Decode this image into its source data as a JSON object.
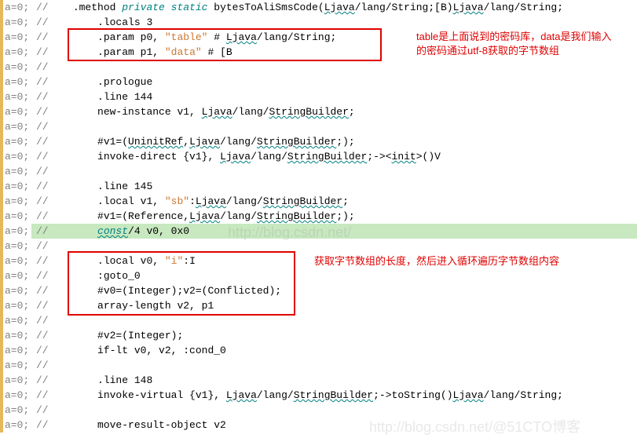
{
  "gutter_text": "a=0;",
  "comment_prefix": "//",
  "lines": [
    {
      "indent": 1,
      "segs": [
        {
          "t": ".method ",
          "cls": ""
        },
        {
          "t": "private static ",
          "cls": "kw"
        },
        {
          "t": "bytesToAliSmsCode(",
          "cls": ""
        },
        {
          "t": "Ljava",
          "cls": "wavy"
        },
        {
          "t": "/lang/String;[B)",
          "cls": ""
        },
        {
          "t": "Ljava",
          "cls": "wavy"
        },
        {
          "t": "/lang/String;",
          "cls": ""
        }
      ]
    },
    {
      "indent": 2,
      "segs": [
        {
          "t": ".locals 3",
          "cls": ""
        }
      ]
    },
    {
      "indent": 2,
      "segs": [
        {
          "t": ".param p0, ",
          "cls": ""
        },
        {
          "t": "\"table\"",
          "cls": "str"
        },
        {
          "t": "    # ",
          "cls": ""
        },
        {
          "t": "Ljava",
          "cls": "wavy"
        },
        {
          "t": "/lang/String;",
          "cls": ""
        }
      ]
    },
    {
      "indent": 2,
      "segs": [
        {
          "t": ".param p1, ",
          "cls": ""
        },
        {
          "t": "\"data\"",
          "cls": "str"
        },
        {
          "t": "    # [B",
          "cls": ""
        }
      ]
    },
    {
      "indent": 0,
      "segs": []
    },
    {
      "indent": 2,
      "segs": [
        {
          "t": ".prologue",
          "cls": ""
        }
      ]
    },
    {
      "indent": 2,
      "segs": [
        {
          "t": ".line 144",
          "cls": ""
        }
      ]
    },
    {
      "indent": 2,
      "segs": [
        {
          "t": "new-instance v1, ",
          "cls": ""
        },
        {
          "t": "Ljava",
          "cls": "wavy"
        },
        {
          "t": "/lang/",
          "cls": ""
        },
        {
          "t": "StringBuilder",
          "cls": "wavy"
        },
        {
          "t": ";",
          "cls": ""
        }
      ]
    },
    {
      "indent": 0,
      "segs": []
    },
    {
      "indent": 2,
      "segs": [
        {
          "t": "#v1=(",
          "cls": ""
        },
        {
          "t": "UninitRef",
          "cls": "wavy"
        },
        {
          "t": ",",
          "cls": ""
        },
        {
          "t": "Ljava",
          "cls": "wavy"
        },
        {
          "t": "/lang/",
          "cls": ""
        },
        {
          "t": "StringBuilder",
          "cls": "wavy"
        },
        {
          "t": ";);",
          "cls": ""
        }
      ]
    },
    {
      "indent": 2,
      "segs": [
        {
          "t": "invoke-direct {v1}, ",
          "cls": ""
        },
        {
          "t": "Ljava",
          "cls": "wavy"
        },
        {
          "t": "/lang/",
          "cls": ""
        },
        {
          "t": "StringBuilder",
          "cls": "wavy"
        },
        {
          "t": ";-><",
          "cls": ""
        },
        {
          "t": "init",
          "cls": "wavy"
        },
        {
          "t": ">()V",
          "cls": ""
        }
      ]
    },
    {
      "indent": 0,
      "segs": []
    },
    {
      "indent": 2,
      "segs": [
        {
          "t": ".line 145",
          "cls": ""
        }
      ]
    },
    {
      "indent": 2,
      "segs": [
        {
          "t": ".local v1, ",
          "cls": ""
        },
        {
          "t": "\"sb\"",
          "cls": "str"
        },
        {
          "t": ":",
          "cls": ""
        },
        {
          "t": "Ljava",
          "cls": "wavy"
        },
        {
          "t": "/lang/",
          "cls": ""
        },
        {
          "t": "StringBuilder",
          "cls": "wavy"
        },
        {
          "t": ";",
          "cls": ""
        }
      ]
    },
    {
      "indent": 2,
      "segs": [
        {
          "t": "#v1=(Reference,",
          "cls": ""
        },
        {
          "t": "Ljava",
          "cls": "wavy"
        },
        {
          "t": "/lang/",
          "cls": ""
        },
        {
          "t": "StringBuilder",
          "cls": "wavy"
        },
        {
          "t": ";);",
          "cls": ""
        }
      ]
    },
    {
      "indent": 2,
      "hl": true,
      "segs": [
        {
          "t": "const",
          "cls": "wavy kw"
        },
        {
          "t": "/4 v0, 0x0",
          "cls": ""
        }
      ]
    },
    {
      "indent": 0,
      "segs": []
    },
    {
      "indent": 2,
      "segs": [
        {
          "t": ".local v0, ",
          "cls": ""
        },
        {
          "t": "\"i\"",
          "cls": "str"
        },
        {
          "t": ":I",
          "cls": ""
        }
      ]
    },
    {
      "indent": 2,
      "segs": [
        {
          "t": ":goto_0",
          "cls": ""
        }
      ]
    },
    {
      "indent": 2,
      "segs": [
        {
          "t": "#v0=(Integer);v2=(Conflicted);",
          "cls": ""
        }
      ]
    },
    {
      "indent": 2,
      "segs": [
        {
          "t": "array-length v2, p1",
          "cls": ""
        }
      ]
    },
    {
      "indent": 0,
      "segs": []
    },
    {
      "indent": 2,
      "segs": [
        {
          "t": "#v2=(Integer);",
          "cls": ""
        }
      ]
    },
    {
      "indent": 2,
      "segs": [
        {
          "t": "if-lt v0, v2, :cond_0",
          "cls": ""
        }
      ]
    },
    {
      "indent": 0,
      "segs": []
    },
    {
      "indent": 2,
      "segs": [
        {
          "t": ".line 148",
          "cls": ""
        }
      ]
    },
    {
      "indent": 2,
      "segs": [
        {
          "t": "invoke-virtual {v1}, ",
          "cls": ""
        },
        {
          "t": "Ljava",
          "cls": "wavy"
        },
        {
          "t": "/lang/",
          "cls": ""
        },
        {
          "t": "StringBuilder",
          "cls": "wavy"
        },
        {
          "t": ";->toString()",
          "cls": ""
        },
        {
          "t": "Ljava",
          "cls": "wavy"
        },
        {
          "t": "/lang/String;",
          "cls": ""
        }
      ]
    },
    {
      "indent": 0,
      "segs": []
    },
    {
      "indent": 2,
      "segs": [
        {
          "t": "move-result-object v2",
          "cls": ""
        }
      ]
    }
  ],
  "annotations": {
    "a1": "table是上面说到的密码库，data是我们输入的密码通过utf-8获取的字节数组",
    "a2": "获取字节数组的长度，然后进入循环遍历字节数组内容"
  },
  "watermarks": {
    "w1": "http://blog.csdn.net/",
    "w2": "http://blog.csdn.net/@51CTO博客"
  }
}
